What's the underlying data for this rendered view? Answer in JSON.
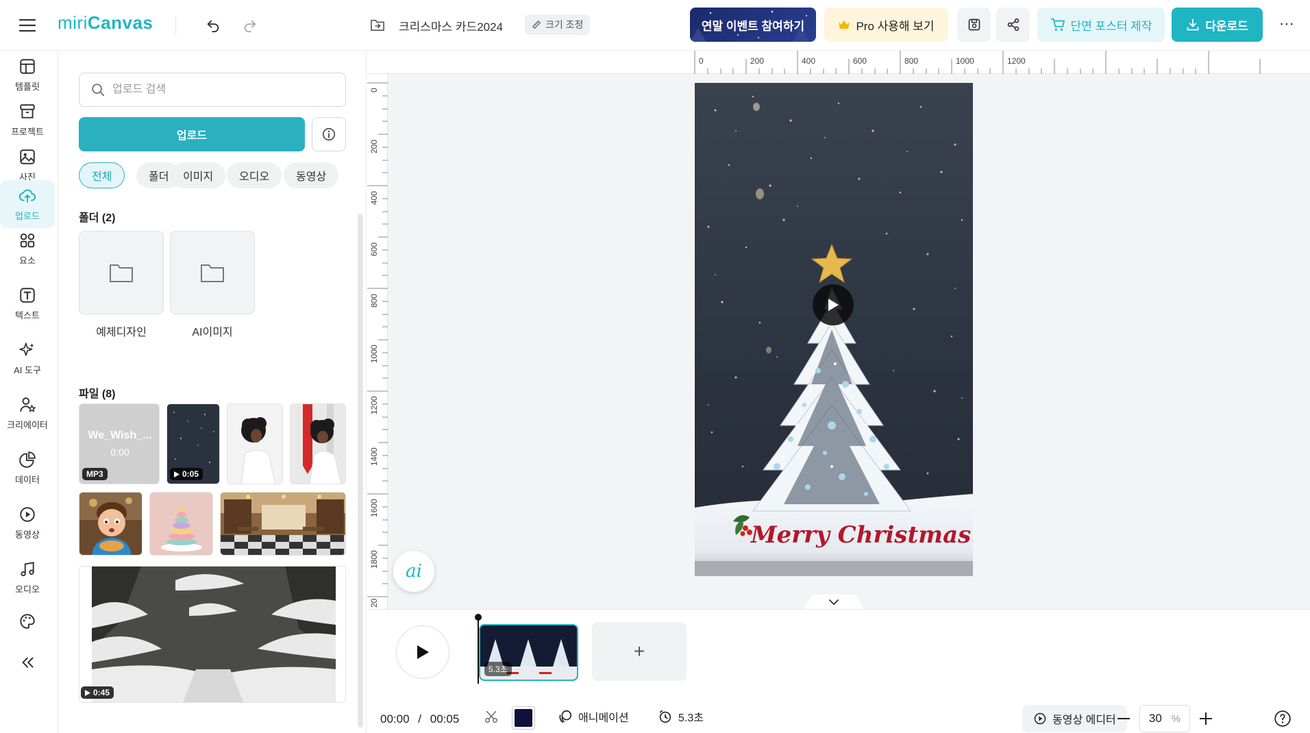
{
  "app": {
    "logo_text_a": "miri",
    "logo_text_b": "Canvas",
    "doc_title": "크리스마스 카드2024",
    "resize_label": "크기 조정",
    "event_label": "연말 이벤트 참여하기",
    "pro_label": "Pro 사용해 보기",
    "poster_label": "단면 포스터 제작",
    "download_label": "다운로드",
    "brand_color": "#1fb5c3"
  },
  "rail": {
    "items": [
      {
        "label": "템플릿",
        "icon": "template-icon"
      },
      {
        "label": "프로젝트",
        "icon": "archive-icon"
      },
      {
        "label": "사진",
        "icon": "image-icon"
      },
      {
        "label": "업로드",
        "icon": "cloud-upload-icon",
        "active": true
      },
      {
        "label": "요소",
        "icon": "shapes-icon"
      },
      {
        "label": "텍스트",
        "icon": "text-icon"
      },
      {
        "label": "AI 도구",
        "icon": "sparkle-icon"
      },
      {
        "label": "크리에이터",
        "icon": "creator-icon"
      },
      {
        "label": "데이터",
        "icon": "chart-icon"
      },
      {
        "label": "동영상",
        "icon": "play-circle-icon"
      },
      {
        "label": "오디오",
        "icon": "music-icon"
      }
    ]
  },
  "panel": {
    "search_placeholder": "업로드 검색",
    "upload_label": "업로드",
    "filters": [
      "전체",
      "폴더",
      "이미지",
      "오디오",
      "동영상"
    ],
    "active_filter": "전체",
    "folders_title": "폴더 (2)",
    "folders": [
      "예제디자인",
      "AI이미지"
    ],
    "files_title": "파일 (8)",
    "audio_file": {
      "name": "We_Wish_...",
      "duration": "0:00",
      "badge": "MP3"
    },
    "video_badge_1": "0:05",
    "video_badge_2": "0:45"
  },
  "canvas": {
    "ruler_x": [
      "0",
      "200",
      "400",
      "600",
      "800",
      "1000",
      "1200"
    ],
    "ruler_y": [
      "0",
      "200",
      "400",
      "600",
      "800",
      "1000",
      "1200",
      "1400",
      "1600",
      "1800",
      "20"
    ],
    "greeting": "Merry Christmas!",
    "ai_label": "ai"
  },
  "timeline": {
    "clip_duration": "5.3초",
    "current_time": "00:00",
    "separator": "/",
    "total_time": "00:05",
    "animation_label": "애니메이션",
    "duration_label": "5.3초",
    "video_editor_label": "동영상 에디터",
    "zoom_value": "30",
    "zoom_unit": "%",
    "bg_color": "#0e1138"
  }
}
